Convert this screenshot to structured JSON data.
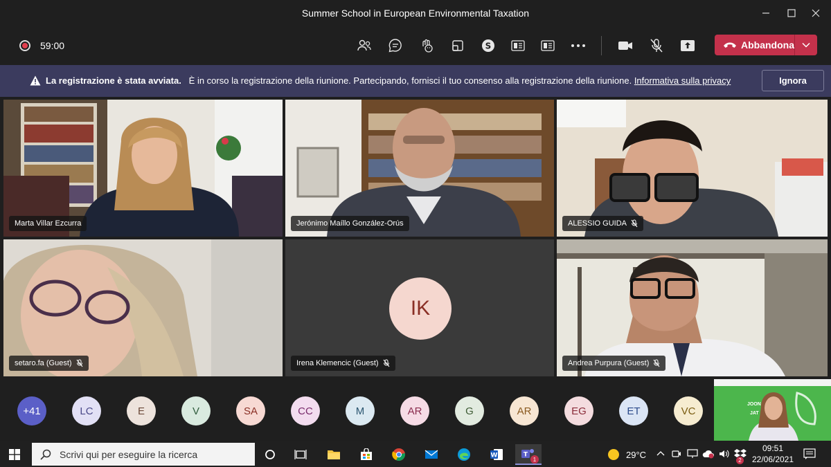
{
  "window": {
    "title": "Summer School in European Environmental Taxation"
  },
  "toolbar": {
    "timer": "59:00",
    "leave_label": "Abbandona"
  },
  "banner": {
    "bold_text": "La registrazione è stata avviata.",
    "text": "È in corso la registrazione della riunione. Partecipando, fornisci il tuo consenso alla registrazione della riunione.",
    "link": "Informativa sulla privacy",
    "ignore_label": "Ignora"
  },
  "tiles": [
    {
      "name": "Marta Villar Ezcurra",
      "muted": false
    },
    {
      "name": "Jerónimo Maíllo González-Orús",
      "muted": false
    },
    {
      "name": "ALESSIO GUIDA",
      "muted": true
    },
    {
      "name": "setaro.fa (Guest)",
      "muted": true
    },
    {
      "name": "Irena Klemencic (Guest)",
      "muted": true,
      "initials": "IK"
    },
    {
      "name": "Andrea Purpura (Guest)",
      "muted": true
    }
  ],
  "participants": [
    {
      "initials": "+41",
      "bg": "#5b5fc7",
      "fg": "#ffffff"
    },
    {
      "initials": "LC",
      "bg": "#e2e0f5",
      "fg": "#4b4a8a"
    },
    {
      "initials": "E",
      "bg": "#ede3dc",
      "fg": "#6b4a3a"
    },
    {
      "initials": "V",
      "bg": "#d9eadf",
      "fg": "#2f5b3c"
    },
    {
      "initials": "SA",
      "bg": "#f7d9d3",
      "fg": "#8a2f25"
    },
    {
      "initials": "CC",
      "bg": "#f3dcef",
      "fg": "#7a2c6c"
    },
    {
      "initials": "M",
      "bg": "#dbe9f1",
      "fg": "#2b5670"
    },
    {
      "initials": "AR",
      "bg": "#f6dbe5",
      "fg": "#8a2c4e"
    },
    {
      "initials": "G",
      "bg": "#e2ebe0",
      "fg": "#3e5b34"
    },
    {
      "initials": "AR",
      "bg": "#f7e6d3",
      "fg": "#8a5a20"
    },
    {
      "initials": "EG",
      "bg": "#f4dcdf",
      "fg": "#8a2c3a"
    },
    {
      "initials": "ET",
      "bg": "#dbe5f5",
      "fg": "#2b4a8a"
    },
    {
      "initials": "VC",
      "bg": "#f6ecd0",
      "fg": "#7a5c10"
    }
  ],
  "selfview": {
    "text_1": "JOON",
    "text_2": "JAT"
  },
  "taskbar": {
    "search_placeholder": "Scrivi qui per eseguire la ricerca",
    "weather": "29°C",
    "time": "09:51",
    "date": "22/06/2021",
    "teams_badge": "1",
    "notif_badge": "2"
  }
}
